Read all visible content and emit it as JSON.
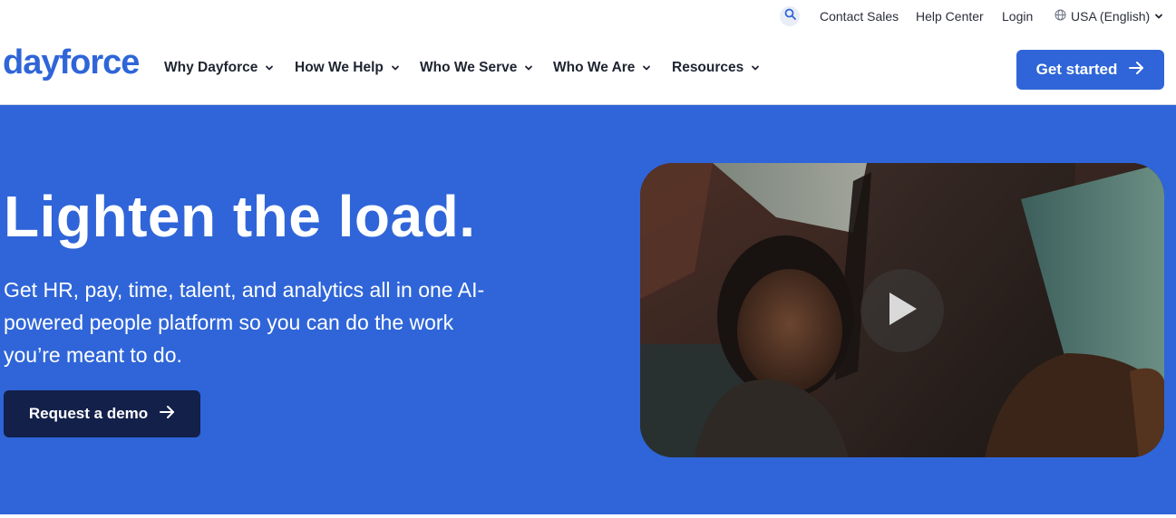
{
  "utility": {
    "search_icon": "search-icon",
    "contact_sales": "Contact Sales",
    "help_center": "Help Center",
    "login": "Login",
    "locale": "USA (English)",
    "locale_icon": "globe-icon"
  },
  "nav": {
    "logo": "dayforce",
    "items": [
      {
        "label": "Why Dayforce"
      },
      {
        "label": "How We Help"
      },
      {
        "label": "Who We Serve"
      },
      {
        "label": "Who We Are"
      },
      {
        "label": "Resources"
      }
    ],
    "cta_label": "Get started"
  },
  "hero": {
    "title": "Lighten the load.",
    "subtitle": "Get HR, pay, time, talent, and analytics all in one AI-powered people platform so you can do the work you’re meant to do.",
    "demo_label": "Request a demo",
    "video_icon": "play-icon"
  },
  "colors": {
    "brand_blue": "#2f65d8",
    "dark_navy": "#13204a",
    "text_dark": "#1f2430"
  }
}
